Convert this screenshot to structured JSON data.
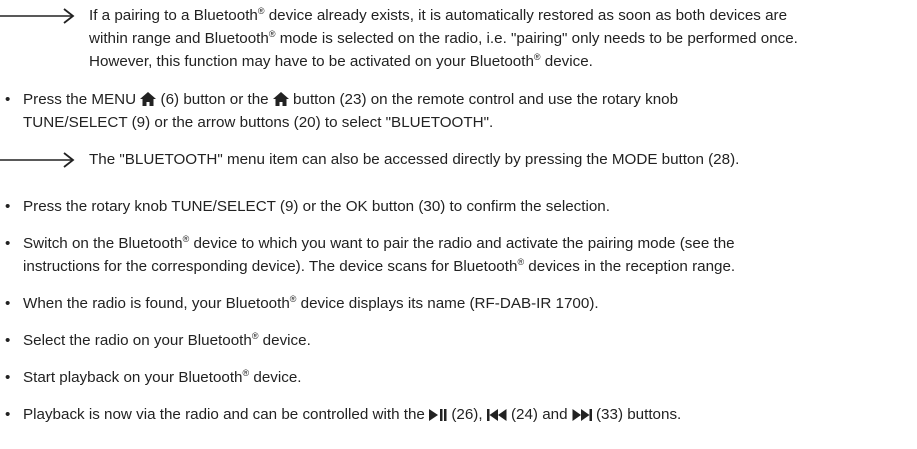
{
  "note1": {
    "l1a": "If a pairing to a Bluetooth",
    "l1b": " device already exists, it is automatically restored as soon as both devices are",
    "l2a": "within range and Bluetooth",
    "l2b": " mode is selected on the radio, i.e. \"pairing\" only needs to be performed once.",
    "l3a": "However, this function may have to be activated on your Bluetooth",
    "l3b": " device."
  },
  "reg": "®",
  "bullet_dot": "•",
  "b1": {
    "a": "Press the MENU ",
    "b": " (6) button or the ",
    "c": " button (23) on the remote control and use the rotary knob",
    "d": "TUNE/SELECT (9) or the arrow buttons (20) to select \"BLUETOOTH\"."
  },
  "note2": "The \"BLUETOOTH\" menu item can also be accessed directly by pressing the MODE button (28).",
  "b2": "Press the rotary knob TUNE/SELECT (9) or the OK button (30) to confirm the selection.",
  "b3": {
    "a": "Switch on the Bluetooth",
    "b": " device to which you want to pair the radio and activate the pairing mode (see the",
    "c": "instructions for the corresponding device). The device scans for Bluetooth",
    "d": " devices in the reception range."
  },
  "b4": {
    "a": "When the radio is found, your Bluetooth",
    "b": " device displays its name (RF-DAB-IR 1700)."
  },
  "b5": {
    "a": "Select the radio on your Bluetooth",
    "b": " device."
  },
  "b6": {
    "a": "Start playback on your Bluetooth",
    "b": " device."
  },
  "b7": {
    "a": "Playback is now via the radio and can be controlled with the ",
    "b": " (26), ",
    "c": " (24) and ",
    "d": " (33) buttons."
  },
  "icons": [
    "arrow-right-icon",
    "home-icon",
    "play-pause-icon",
    "skip-back-icon",
    "skip-forward-icon"
  ]
}
